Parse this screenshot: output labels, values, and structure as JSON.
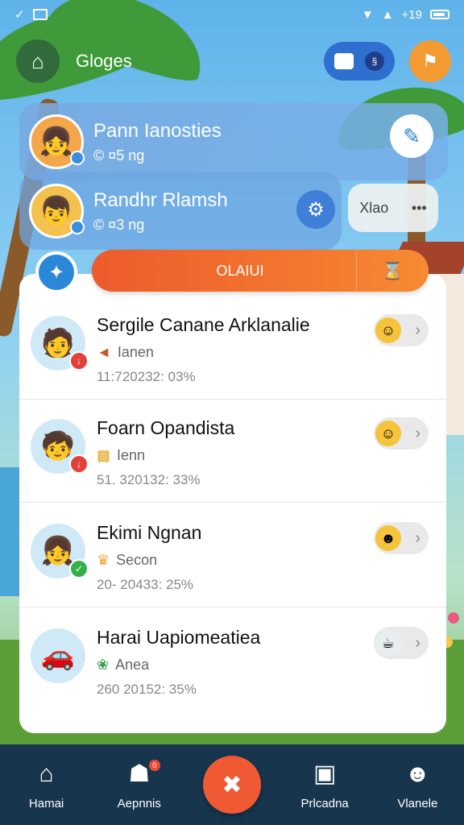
{
  "status_bar": {
    "time": "+19"
  },
  "header": {
    "title": "Gloges",
    "pill_badge": "§"
  },
  "profiles": [
    {
      "name": "Pann Ianosties",
      "stat": "© ¤5 ng",
      "avatar": "👧"
    },
    {
      "name": "Randhr Rlamsh",
      "stat": "© ¤3 ng",
      "avatar": "👦"
    }
  ],
  "chip": {
    "label": "Xlao",
    "more": "•••"
  },
  "action_bar": {
    "label": "OLAIUI"
  },
  "list": [
    {
      "name": "Sergile Canane Arklanalie",
      "sub": "Ianen",
      "meta": "11:720232: 03%",
      "avatar": "🧑",
      "badge": "↓",
      "badge_color": "#e2403a"
    },
    {
      "name": "Foarn Opandista",
      "sub": "Ienn",
      "meta": "51. 320132: 33%",
      "avatar": "🧒",
      "badge": "↓",
      "badge_color": "#e2403a"
    },
    {
      "name": "Ekimi Ngnan",
      "sub": "Secon",
      "meta": "20- 20433: 25%",
      "avatar": "👧",
      "badge": "✓",
      "badge_color": "#34b04a"
    },
    {
      "name": "Harai Uapiomeatiea",
      "sub": "Anea",
      "meta": "260 20152: 35%",
      "avatar": "🚗",
      "badge": "",
      "badge_color": ""
    }
  ],
  "nav": [
    {
      "label": "Hamai",
      "icon": "home-icon"
    },
    {
      "label": "Aepnnis",
      "icon": "tag-icon",
      "dot": "0"
    },
    {
      "label": "",
      "icon": "cancel-x-icon"
    },
    {
      "label": "Prlcadna",
      "icon": "card-icon"
    },
    {
      "label": "Vlanele",
      "icon": "person-icon"
    }
  ],
  "colors": {
    "accent": "#ef5a35",
    "nav_bg": "#17364e",
    "primary_blue": "#2f6fd0"
  }
}
